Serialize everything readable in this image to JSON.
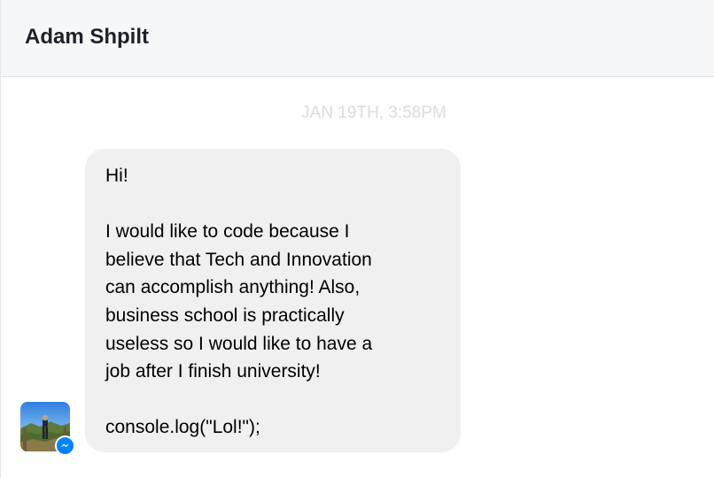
{
  "header": {
    "contact_name": "Adam Shpilt"
  },
  "conversation": {
    "timestamp": "JAN 19TH, 3:58PM",
    "message": {
      "line_greeting": "Hi!",
      "body": "I would like to code because I\nbelieve that Tech and Innovation\ncan accomplish anything! Also,\nbusiness school is practically\nuseless so I would like to have a\njob after I finish university!",
      "code_line": "console.log(\"Lol!\");"
    }
  },
  "avatar": {
    "icon": "messenger-icon",
    "badge_color": "#0084ff"
  }
}
